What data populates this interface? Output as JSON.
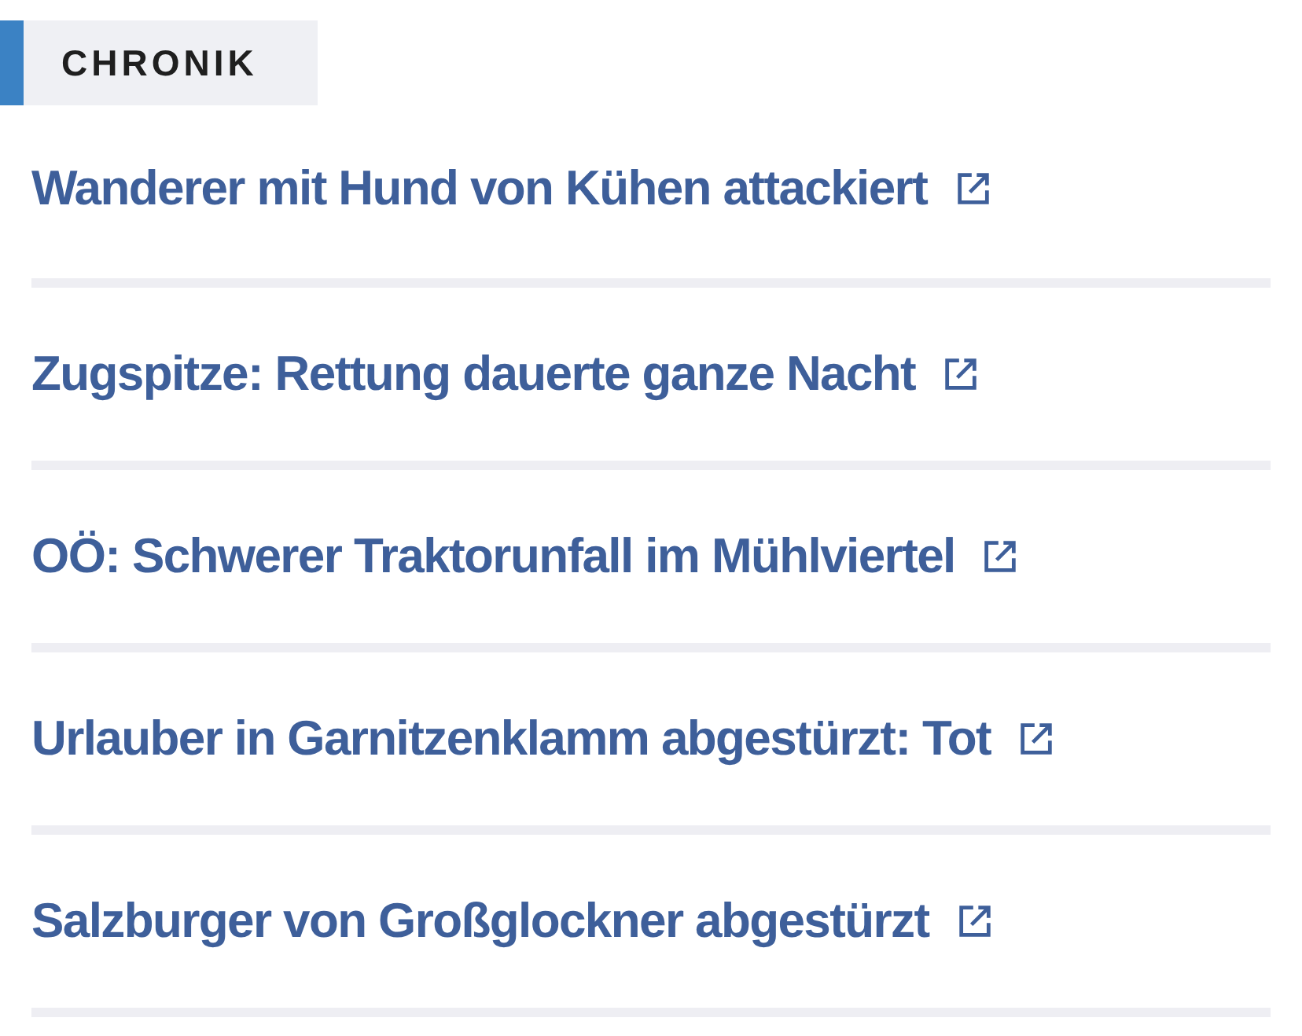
{
  "section": {
    "title": "CHRONIK"
  },
  "articles": [
    {
      "title": "Wanderer mit Hund von Kühen attackiert"
    },
    {
      "title": "Zugspitze: Rettung dauerte ganze Nacht"
    },
    {
      "title": "OÖ: Schwerer Traktorunfall im Mühlviertel"
    },
    {
      "title": "Urlauber in Garnitzenklamm abgestürzt: Tot"
    },
    {
      "title": "Salzburger von Großglockner abgestürzt"
    }
  ]
}
